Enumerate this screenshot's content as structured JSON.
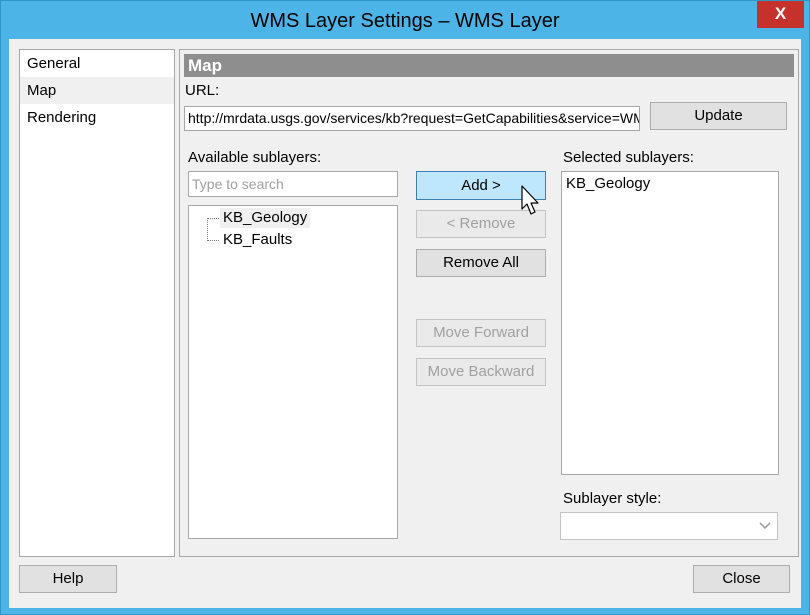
{
  "window": {
    "title": "WMS Layer Settings – WMS Layer",
    "close_glyph": "X"
  },
  "nav": {
    "items": [
      {
        "label": "General"
      },
      {
        "label": "Map"
      },
      {
        "label": "Rendering"
      }
    ],
    "selected": "Map"
  },
  "map": {
    "section_title": "Map",
    "url_label": "URL:",
    "url_value": "http://mrdata.usgs.gov/services/kb?request=GetCapabilities&service=WMS",
    "update_label": "Update",
    "available_label": "Available sublayers:",
    "search_placeholder": "Type to search",
    "available_items": [
      "KB_Geology",
      "KB_Faults"
    ],
    "highlighted_available": "KB_Geology",
    "selected_label": "Selected sublayers:",
    "selected_items": [
      "KB_Geology"
    ],
    "add_label": "Add >",
    "remove_label": "< Remove",
    "remove_all_label": "Remove All",
    "move_forward_label": "Move Forward",
    "move_backward_label": "Move Backward",
    "style_label": "Sublayer style:",
    "style_value": ""
  },
  "footer": {
    "help_label": "Help",
    "close_label": "Close"
  },
  "icons": {
    "close": "close-icon",
    "dropdown": "chevron-down-icon",
    "pointer": "mouse-pointer-icon"
  },
  "colors": {
    "titlebar": "#4cb4e6",
    "close_button": "#c7312b",
    "section_header": "#8e8e8e",
    "hot_button": "#bee6fd"
  }
}
